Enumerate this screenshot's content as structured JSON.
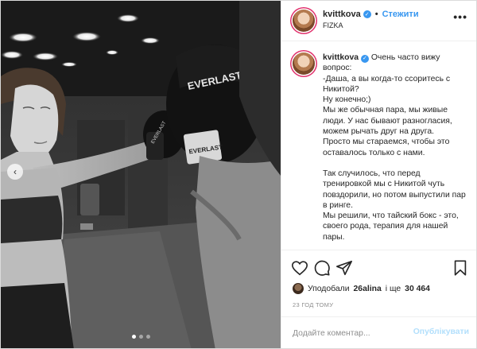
{
  "post": {
    "username": "kvittkova",
    "verified": true,
    "separator": "•",
    "follow_label": "Стежити",
    "location": "FIZKA",
    "more_label": "•••"
  },
  "media": {
    "carousel_total": 3,
    "carousel_active": 1,
    "prev_glyph": "‹"
  },
  "caption": {
    "username": "kvittkova",
    "lines": [
      "Очень часто вижу вопрос:",
      "-Даша, а вы когда-то ссоритесь с Никитой?",
      "Ну конечно;)",
      "Мы же обычная пара, мы живые люди. У нас бывают разногласия, можем рычать друг на друга.",
      "Просто мы стараемся, чтобы это оставалось только с нами."
    ],
    "lines2": [
      "Так случилось, что перед тренировкой мы с Никитой чуть повздорили, но потом выпустили пар в ринге.",
      "Мы решили, что тайский бокс - это, своего рода, терапия для нашей пары."
    ]
  },
  "actions": {
    "like_icon": "heart-icon",
    "comment_icon": "comment-icon",
    "share_icon": "share-icon",
    "save_icon": "bookmark-icon"
  },
  "likes": {
    "prefix": "Уподобали",
    "user": "26alina",
    "connector": "і ще",
    "count": "30 464"
  },
  "timestamp": "23 ГОД ТОМУ",
  "comment_box": {
    "placeholder": "Додайте коментар...",
    "publish_label": "Опублікувати"
  },
  "colors": {
    "accent": "#3897f0",
    "publish_disabled": "#b2dffc",
    "muted": "#8e8e8e"
  }
}
